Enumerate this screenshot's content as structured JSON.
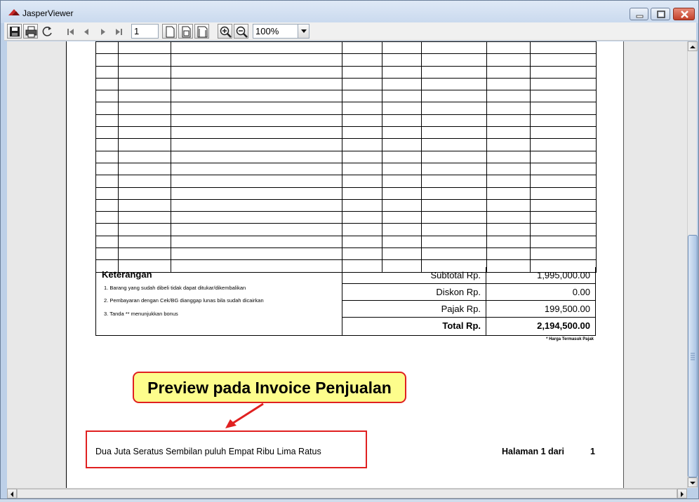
{
  "window": {
    "title": "JasperViewer"
  },
  "toolbar": {
    "page_number": "1",
    "zoom": "100%",
    "buttons": [
      "save-icon",
      "print-icon",
      "reload-icon",
      "first-page-icon",
      "previous-page-icon",
      "next-page-icon",
      "last-page-icon",
      "actual-size-icon",
      "fit-page-icon",
      "fit-width-icon",
      "zoom-in-icon",
      "zoom-out-icon"
    ]
  },
  "invoice": {
    "notes": {
      "title": "Keterangan",
      "items": [
        "1. Barang yang sudah dibeli tidak dapat ditukar/dikembalikan",
        "2. Pembayaran dengan Cek/BG dianggap lunas bila sudah dicairkan",
        "3. Tanda ** menunjukkan bonus"
      ]
    },
    "summary": {
      "subtotal_label": "Subtotal Rp.",
      "subtotal_value": "1,995,000.00",
      "diskon_label": "Diskon Rp.",
      "diskon_value": "0.00",
      "pajak_label": "Pajak Rp.",
      "pajak_value": "199,500.00",
      "total_label": "Total Rp.",
      "total_value": "2,194,500.00"
    },
    "tax_note": "* Harga Termasuk Pajak",
    "amount_in_words": "Dua Juta Seratus Sembilan puluh Empat Ribu Lima Ratus",
    "page_label": "Halaman 1 dari",
    "page_total": "1"
  },
  "annotation": {
    "callout_text": "Preview pada Invoice Penjualan",
    "accent_color": "#e02020",
    "callout_fill": "#fdfd8c"
  }
}
